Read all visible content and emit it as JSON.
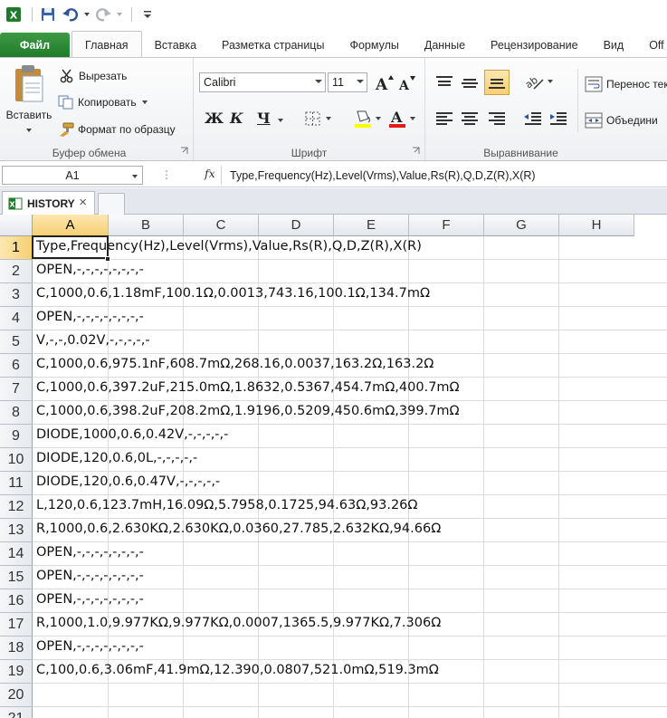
{
  "ribbon_tabs": [
    "Файл",
    "Главная",
    "Вставка",
    "Разметка страницы",
    "Формулы",
    "Данные",
    "Рецензирование",
    "Вид",
    "Off"
  ],
  "clipboard": {
    "paste": "Вставить",
    "cut": "Вырезать",
    "copy": "Копировать",
    "format_painter": "Формат по образцу",
    "label": "Буфер обмена"
  },
  "font": {
    "name": "Calibri",
    "size": "11",
    "bold": "Ж",
    "italic": "К",
    "underline": "Ч",
    "label": "Шрифт"
  },
  "alignment": {
    "wrap": "Перенос тек",
    "merge": "Объедини",
    "label": "Выравнивание"
  },
  "formula_bar": {
    "name_box": "A1",
    "fx": "fx",
    "content": "Type,Frequency(Hz),Level(Vrms),Value,Rs(R),Q,D,Z(R),X(R)"
  },
  "sheet": {
    "tab_name": "HISTORY",
    "close": "×"
  },
  "columns": [
    "A",
    "B",
    "C",
    "D",
    "E",
    "F",
    "G",
    "H"
  ],
  "rows": [
    {
      "n": "1",
      "text": "Type,Frequency(Hz),Level(Vrms),Value,Rs(R),Q,D,Z(R),X(R)"
    },
    {
      "n": "2",
      "text": "OPEN,-,-,-,-,-,-,-,-"
    },
    {
      "n": "3",
      "text": "C,1000,0.6,1.18mF,100.1Ω,0.0013,743.16,100.1Ω,134.7mΩ"
    },
    {
      "n": "4",
      "text": "OPEN,-,-,-,-,-,-,-,-"
    },
    {
      "n": "5",
      "text": "V,-,-,0.02V,-,-,-,-,-"
    },
    {
      "n": "6",
      "text": "C,1000,0.6,975.1nF,608.7mΩ,268.16,0.0037,163.2Ω,163.2Ω"
    },
    {
      "n": "7",
      "text": "C,1000,0.6,397.2uF,215.0mΩ,1.8632,0.5367,454.7mΩ,400.7mΩ"
    },
    {
      "n": "8",
      "text": "C,1000,0.6,398.2uF,208.2mΩ,1.9196,0.5209,450.6mΩ,399.7mΩ"
    },
    {
      "n": "9",
      "text": "DIODE,1000,0.6,0.42V,-,-,-,-,-"
    },
    {
      "n": "10",
      "text": "DIODE,120,0.6,0L,-,-,-,-,-"
    },
    {
      "n": "11",
      "text": "DIODE,120,0.6,0.47V,-,-,-,-,-"
    },
    {
      "n": "12",
      "text": "L,120,0.6,123.7mH,16.09Ω,5.7958,0.1725,94.63Ω,93.26Ω"
    },
    {
      "n": "13",
      "text": "R,1000,0.6,2.630KΩ,2.630KΩ,0.0360,27.785,2.632KΩ,94.66Ω"
    },
    {
      "n": "14",
      "text": "OPEN,-,-,-,-,-,-,-,-"
    },
    {
      "n": "15",
      "text": "OPEN,-,-,-,-,-,-,-,-"
    },
    {
      "n": "16",
      "text": "OPEN,-,-,-,-,-,-,-,-"
    },
    {
      "n": "17",
      "text": "R,1000,1.0,9.977KΩ,9.977KΩ,0.0007,1365.5,9.977KΩ,7.306Ω"
    },
    {
      "n": "18",
      "text": "OPEN,-,-,-,-,-,-,-,-"
    },
    {
      "n": "19",
      "text": "C,100,0.6,3.06mF,41.9mΩ,12.390,0.0807,521.0mΩ,519.3mΩ"
    },
    {
      "n": "20",
      "text": ""
    },
    {
      "n": "21",
      "text": ""
    }
  ],
  "accent_colors": {
    "file_tab": "#2a8a34",
    "selection": "#f7cf74"
  }
}
